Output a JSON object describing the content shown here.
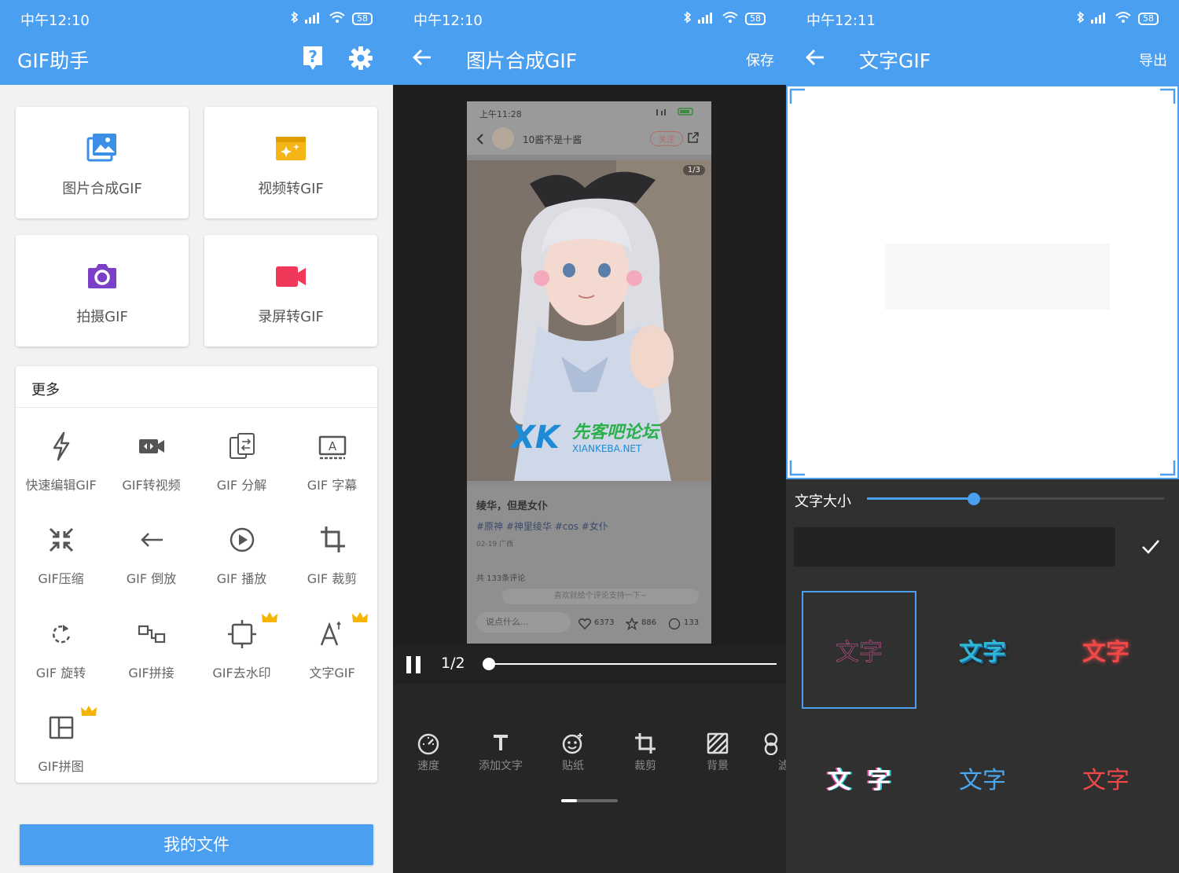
{
  "colors": {
    "primary": "#4a9ff0",
    "accent_pink": "#e85aa8",
    "crown": "#f5b400",
    "dark": "#303030"
  },
  "panel1": {
    "status_time": "中午12:10",
    "battery": "58",
    "title": "GIF助手",
    "icons": [
      "help-icon",
      "gear-icon"
    ],
    "tiles": [
      {
        "label": "图片合成GIF",
        "icon": "image-icon",
        "color": "#3b8fe6"
      },
      {
        "label": "视频转GIF",
        "icon": "video-sparkle-icon",
        "color": "#f6b516"
      },
      {
        "label": "拍摄GIF",
        "icon": "camera-icon",
        "color": "#7b3fc8"
      },
      {
        "label": "录屏转GIF",
        "icon": "record-icon",
        "color": "#f0395a"
      }
    ],
    "more_title": "更多",
    "tools": [
      {
        "label": "快速编辑GIF",
        "icon": "lightning-icon",
        "premium": false
      },
      {
        "label": "GIF转视频",
        "icon": "video-convert-icon",
        "premium": false
      },
      {
        "label": "GIF 分解",
        "icon": "split-icon",
        "premium": false
      },
      {
        "label": "GIF 字幕",
        "icon": "subtitle-icon",
        "premium": false
      },
      {
        "label": "GIF压缩",
        "icon": "compress-icon",
        "premium": false
      },
      {
        "label": "GIF 倒放",
        "icon": "reverse-icon",
        "premium": false
      },
      {
        "label": "GIF 播放",
        "icon": "play-icon",
        "premium": false
      },
      {
        "label": "GIF 裁剪",
        "icon": "crop-icon",
        "premium": false
      },
      {
        "label": "GIF 旋转",
        "icon": "rotate-icon",
        "premium": false
      },
      {
        "label": "GIF拼接",
        "icon": "join-icon",
        "premium": false
      },
      {
        "label": "GIF去水印",
        "icon": "watermark-remove-icon",
        "premium": true
      },
      {
        "label": "文字GIF",
        "icon": "text-icon",
        "premium": true
      },
      {
        "label": "GIF拼图",
        "icon": "collage-icon",
        "premium": true
      }
    ],
    "my_files": "我的文件"
  },
  "panel2": {
    "status_time": "中午12:10",
    "battery": "58",
    "title": "图片合成GIF",
    "save": "保存",
    "preview": {
      "time": "上午11:28",
      "user": "10酱不是十酱",
      "follow": "关注",
      "page": "1/3",
      "post_title": "绫华，但是女仆",
      "tags": "#原神 #神里绫华 #cos #女仆",
      "date": "02-19 广西",
      "comments_total": "共 133条评论",
      "comment_prompt": "喜欢就给个评论支持一下~",
      "say_something": "说点什么...",
      "likes": "6373",
      "stars": "886",
      "comments": "133",
      "watermark_site": "先客吧论坛",
      "watermark_url": "XIANKEBA.NET",
      "watermark_logo": "XK"
    },
    "frame_counter": "1/2",
    "progress": 0.0,
    "tools": [
      {
        "label": "速度",
        "icon": "speed-icon"
      },
      {
        "label": "添加文字",
        "icon": "text-t-icon"
      },
      {
        "label": "贴纸",
        "icon": "sticker-icon"
      },
      {
        "label": "裁剪",
        "icon": "crop-icon"
      },
      {
        "label": "背景",
        "icon": "background-icon"
      },
      {
        "label": "滤",
        "icon": "filter-icon"
      }
    ]
  },
  "panel3": {
    "status_time": "中午12:11",
    "battery": "58",
    "title": "文字GIF",
    "export": "导出",
    "size_label": "文字大小",
    "size_value": 0.36,
    "styles": [
      {
        "text": "文字",
        "color": "#e85aa8",
        "selected": true
      },
      {
        "text": "文字",
        "color": "#2fb7d6",
        "selected": false
      },
      {
        "text": "文字",
        "color": "#f04848",
        "selected": false
      },
      {
        "text": "文  字",
        "color": "#ffffff",
        "selected": false
      },
      {
        "text": "文字",
        "color": "#4aa7ee",
        "selected": false
      },
      {
        "text": "文字",
        "color": "#f04848",
        "selected": false
      }
    ]
  }
}
